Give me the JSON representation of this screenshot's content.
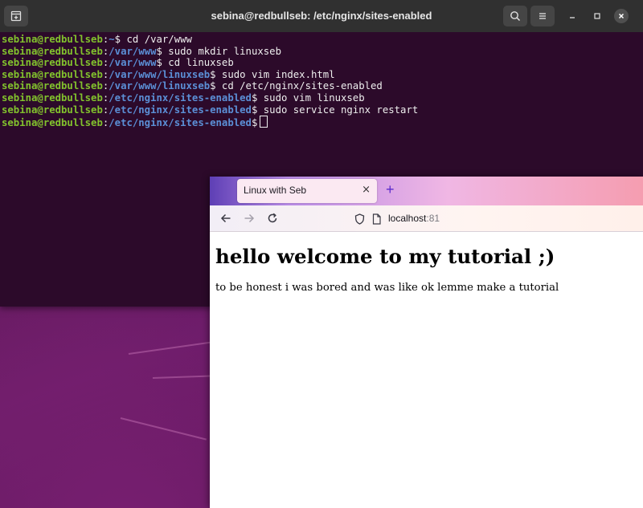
{
  "terminal": {
    "title": "sebina@redbullseb: /etc/nginx/sites-enabled",
    "lines": [
      {
        "user": "sebina@redbullseb",
        "colon": ":",
        "path": "~",
        "cmd": "$ cd /var/www"
      },
      {
        "user": "sebina@redbullseb",
        "colon": ":",
        "path": "/var/www",
        "cmd": "$ sudo mkdir linuxseb"
      },
      {
        "user": "sebina@redbullseb",
        "colon": ":",
        "path": "/var/www",
        "cmd": "$ cd linuxseb"
      },
      {
        "user": "sebina@redbullseb",
        "colon": ":",
        "path": "/var/www/linuxseb",
        "cmd": "$ sudo vim index.html"
      },
      {
        "user": "sebina@redbullseb",
        "colon": ":",
        "path": "/var/www/linuxseb",
        "cmd": "$ cd /etc/nginx/sites-enabled"
      },
      {
        "user": "sebina@redbullseb",
        "colon": ":",
        "path": "/etc/nginx/sites-enabled",
        "cmd": "$ sudo vim linuxseb"
      },
      {
        "user": "sebina@redbullseb",
        "colon": ":",
        "path": "/etc/nginx/sites-enabled",
        "cmd": "$ sudo service nginx restart"
      },
      {
        "user": "sebina@redbullseb",
        "colon": ":",
        "path": "/etc/nginx/sites-enabled",
        "cmd": "$"
      }
    ],
    "colors": {
      "user": "#82c22d",
      "path": "#5b8fd6",
      "background": "#2c0a2a"
    }
  },
  "browser": {
    "tab_title": "Linux with Seb",
    "tab_close": "×",
    "new_tab": "+",
    "url_host": "localhost",
    "url_port": ":81",
    "page": {
      "heading": "hello welcome to my tutorial ;)",
      "paragraph": "to be honest i was bored and was like ok lemme make a tutorial"
    }
  }
}
